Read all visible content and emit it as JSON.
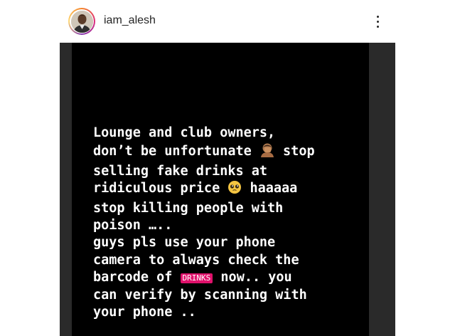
{
  "header": {
    "username": "iam_alesh",
    "avatar_icon": "user-avatar",
    "more_icon": "more-vertical-icon"
  },
  "story": {
    "background_color": "#000000",
    "tag_color": "#e0116b",
    "lines": {
      "l1": "Lounge and club owners,",
      "l2a": "don’t be unfortunate ",
      "l2b": " stop",
      "l3": "selling fake drinks at",
      "l4a": "ridiculous price ",
      "l4b": " haaaaa",
      "l5": "stop killing people with",
      "l6": "poison …..",
      "l7": "guys pls use your phone",
      "l8": "camera to always check the",
      "l9a": "barcode of ",
      "l9tag": "DRINKS",
      "l9b": " now.. you",
      "l10": "can verify by scanning with",
      "l11": "your phone .."
    },
    "emoji_icons": [
      "facepalm-man-icon",
      "pleading-face-icon"
    ]
  }
}
